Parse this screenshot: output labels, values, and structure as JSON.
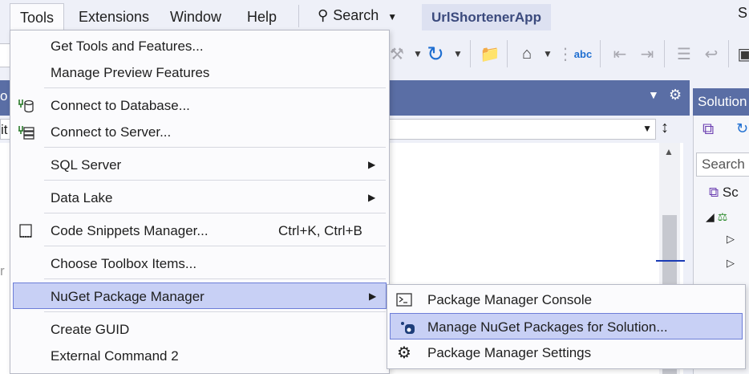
{
  "menubar": {
    "items": [
      {
        "label": "Tools"
      },
      {
        "label": "Extensions"
      },
      {
        "label": "Window"
      },
      {
        "label": "Help"
      }
    ],
    "search_label": "Search",
    "app_title": "UrlShortenerApp",
    "sign_initial": "S"
  },
  "doc": {
    "header_fragment": "o",
    "nav_fragment": "it",
    "editor_fragment": "r"
  },
  "solution": {
    "title": "Solution",
    "search_placeholder": "Search",
    "root_fragment": "Sc"
  },
  "tools_menu": {
    "items": [
      {
        "label": "Get Tools and Features..."
      },
      {
        "label": "Manage Preview Features"
      },
      {
        "label": "Connect to Database..."
      },
      {
        "label": "Connect to Server..."
      },
      {
        "label": "SQL Server"
      },
      {
        "label": "Data Lake"
      },
      {
        "label": "Code Snippets Manager...",
        "shortcut": "Ctrl+K, Ctrl+B"
      },
      {
        "label": "Choose Toolbox Items..."
      },
      {
        "label": "NuGet Package Manager"
      },
      {
        "label": "Create GUID"
      },
      {
        "label": "External Command 2"
      }
    ]
  },
  "nuget_submenu": {
    "items": [
      {
        "label": "Package Manager Console"
      },
      {
        "label": "Manage NuGet Packages for Solution..."
      },
      {
        "label": "Package Manager Settings"
      }
    ]
  },
  "colors": {
    "accent_header": "#5a6ea5",
    "highlight_fill": "#c8d0f5",
    "highlight_border": "#6d7ed8",
    "app_title_text": "#3b4a7d"
  }
}
